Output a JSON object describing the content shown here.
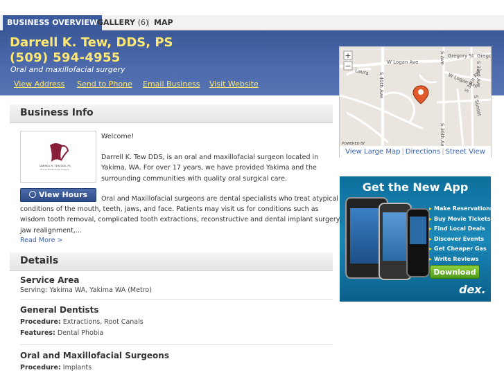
{
  "tabs": [
    {
      "label": "BUSINESS OVERVIEW",
      "count": ""
    },
    {
      "label": "GALLERY",
      "count": "(6)"
    },
    {
      "label": "MAP",
      "count": ""
    }
  ],
  "business": {
    "name": "Darrell K. Tew, DDS, PS",
    "phone": "(509) 594-4955",
    "category": "Oral and maxillofacial surgery"
  },
  "actions": [
    "View Address",
    "Send to Phone",
    "Email Business",
    "Visit Website"
  ],
  "map": {
    "zoom_in": "+",
    "zoom_out": "−",
    "streets": [
      "W Logan Ave",
      "Gregory St",
      "Grego",
      "Laura",
      "S 40th Ave",
      "W Logan Ave",
      "S 33rd Ave",
      "S Ave",
      "S 36th Ave",
      "S 34th Ave",
      "S Sunset",
      "POWERED BY"
    ],
    "links": [
      "View Large Map",
      "Directions",
      "Street View"
    ],
    "marker_color": "#e05a2b"
  },
  "ad": {
    "title": "Get the New App",
    "items": [
      "Make Reservations",
      "Buy Movie Tickets",
      "Find Local Deals",
      "Discover Events",
      "Get Cheaper Gas",
      "Write Reviews"
    ],
    "button": "Download",
    "logo": "dex."
  },
  "info": {
    "heading": "Business Info",
    "hours_button": "View Hours",
    "welcome": "Welcome!",
    "para1": [
      "Darrell K. Tew DDS, is an oral and maxillofacial surgeon located in",
      "Yakima, WA. For over 17 years, we have provided Yakima and the",
      "surrounding communities with quality oral surgical care."
    ],
    "para2_first": "Oral and Maxillofacial surgeons are dental specialists who treat atypical",
    "para2_rest": [
      "conditions of the mouth, teeth, jaws, and face. Patients may visit us for conditions such as",
      "wisdom tooth removal, complicated tooth extractions, reconstructive and dental implant surgery,",
      "jaw realignment,..."
    ],
    "read_more": "Read More >"
  },
  "details": {
    "heading": "Details",
    "service_area_title": "Service Area",
    "service_area_text": "Serving: Yakima WA, Yakima WA (Metro)",
    "general_title": "General Dentists",
    "procedure_label": "Procedure:",
    "general_procedures": "Extractions, Root Canals",
    "features_label": "Features:",
    "general_features": "Dental Phobia",
    "oral_title": "Oral and Maxillofacial Surgeons",
    "oral_procedures": "Implants"
  },
  "colors": {
    "header_blue": "#4e6cae",
    "name_yellow": "#ffe873",
    "link_blue": "#3a63b0",
    "tab_active": "#3a5a9c"
  }
}
